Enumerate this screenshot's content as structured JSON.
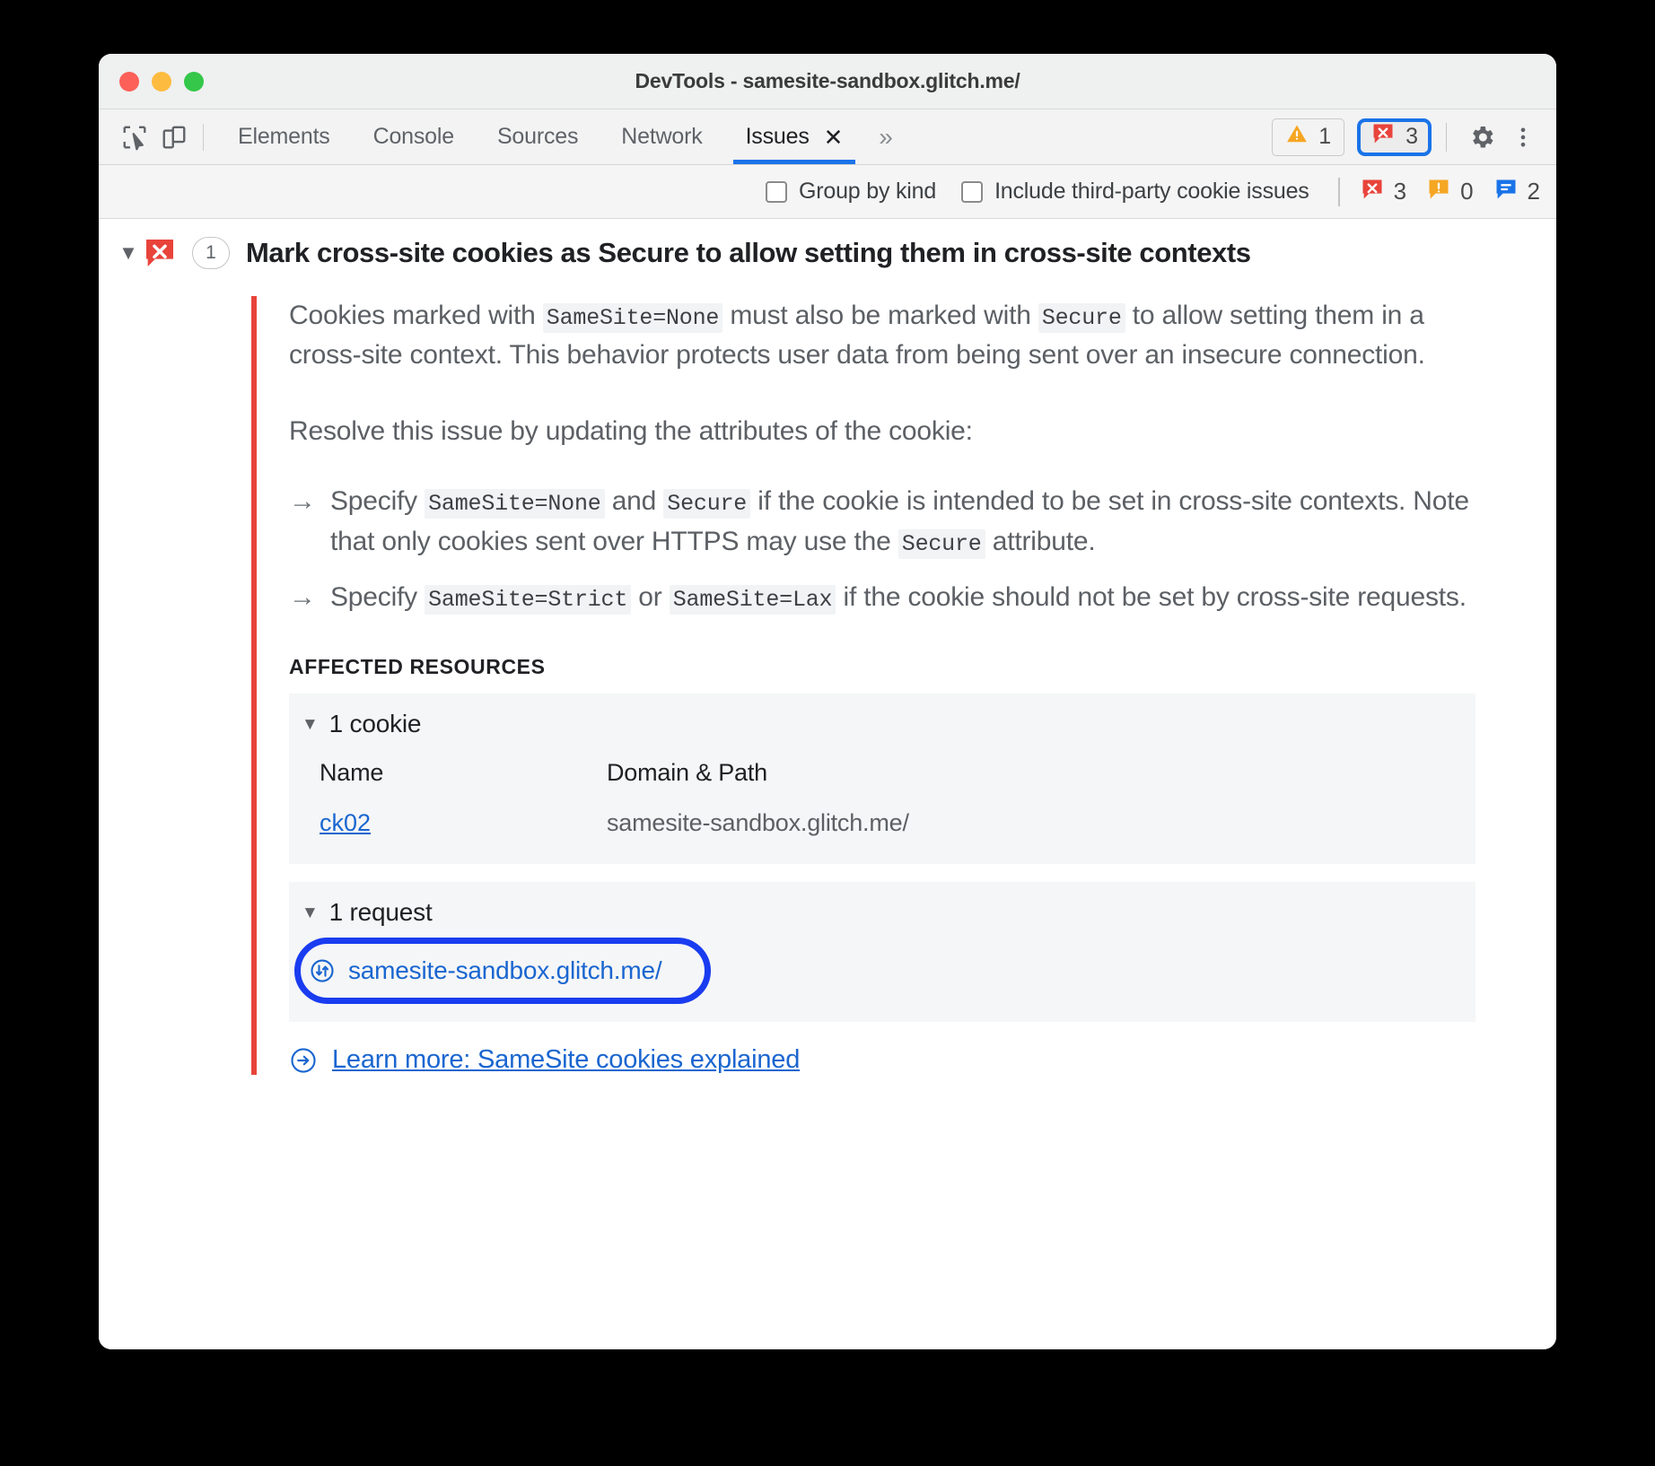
{
  "window": {
    "title": "DevTools - samesite-sandbox.glitch.me/",
    "traffic_lights": [
      "close",
      "minimize",
      "maximize"
    ]
  },
  "toolbar": {
    "inspect_icon": "inspect-element-icon",
    "device_icon": "device-toolbar-icon",
    "tabs": [
      {
        "label": "Elements",
        "active": false
      },
      {
        "label": "Console",
        "active": false
      },
      {
        "label": "Sources",
        "active": false
      },
      {
        "label": "Network",
        "active": false
      },
      {
        "label": "Issues",
        "active": true,
        "closable": true
      }
    ],
    "tab_close_glyph": "✕",
    "more_tabs_glyph": "»",
    "warning_count": "1",
    "error_count": "3",
    "gear_icon": "gear-icon",
    "kebab_icon": "more-options-icon"
  },
  "filterbar": {
    "group_by_kind": "Group by kind",
    "include_third_party": "Include third-party cookie issues",
    "counts": {
      "errors": "3",
      "warnings": "0",
      "info": "2"
    }
  },
  "issue": {
    "count_badge": "1",
    "title": "Mark cross-site cookies as Secure to allow setting them in cross-site contexts",
    "paragraph1": {
      "p1": "Cookies marked with ",
      "c1": "SameSite=None",
      "p2": " must also be marked with ",
      "c2": "Secure",
      "p3": " to allow setting them in a cross-site context. This behavior protects user data from being sent over an insecure connection."
    },
    "paragraph2": "Resolve this issue by updating the attributes of the cookie:",
    "bullet1": {
      "arrow": "→",
      "p1": "Specify ",
      "c1": "SameSite=None",
      "p2": " and ",
      "c2": "Secure",
      "p3": " if the cookie is intended to be set in cross-site contexts. Note that only cookies sent over HTTPS may use the ",
      "c3": "Secure",
      "p4": " attribute."
    },
    "bullet2": {
      "arrow": "→",
      "p1": "Specify ",
      "c1": "SameSite=Strict",
      "p2": " or ",
      "c2": "SameSite=Lax",
      "p3": " if the cookie should not be set by cross-site requests."
    },
    "affected_resources_label": "AFFECTED RESOURCES",
    "cookie_section": {
      "header": "1 cookie",
      "columns": [
        "Name",
        "Domain & Path"
      ],
      "rows": [
        {
          "name": "ck02",
          "domain_path": "samesite-sandbox.glitch.me/"
        }
      ]
    },
    "request_section": {
      "header": "1 request",
      "rows": [
        {
          "url": "samesite-sandbox.glitch.me/",
          "icon": "network-request-icon",
          "highlighted": true
        }
      ]
    },
    "learn_more": {
      "icon": "arrow-in-circle-icon",
      "text": "Learn more: SameSite cookies explained"
    }
  },
  "colors": {
    "error_red": "#e8443b",
    "warning_orange": "#f5a623",
    "info_blue": "#1a73e8",
    "link_blue": "#1a66d0",
    "highlight_blue": "#1a3cf0"
  }
}
